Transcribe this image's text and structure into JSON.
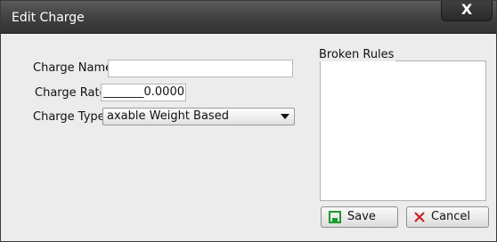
{
  "window": {
    "title": "Edit Charge",
    "close_label": "X"
  },
  "form": {
    "charge_name_label": "Charge Name:",
    "charge_name_value": "",
    "charge_rate_label": "Charge Rate",
    "charge_rate_value": "_______0.0000",
    "charge_type_label": "Charge Type:",
    "charge_type_value": "axable Weight Based"
  },
  "broken_rules": {
    "label": "Broken Rules"
  },
  "buttons": {
    "save_label": "Save",
    "cancel_label": "Cancel"
  },
  "colors": {
    "save_icon": "#1a9a2a",
    "cancel_icon": "#d02020"
  }
}
